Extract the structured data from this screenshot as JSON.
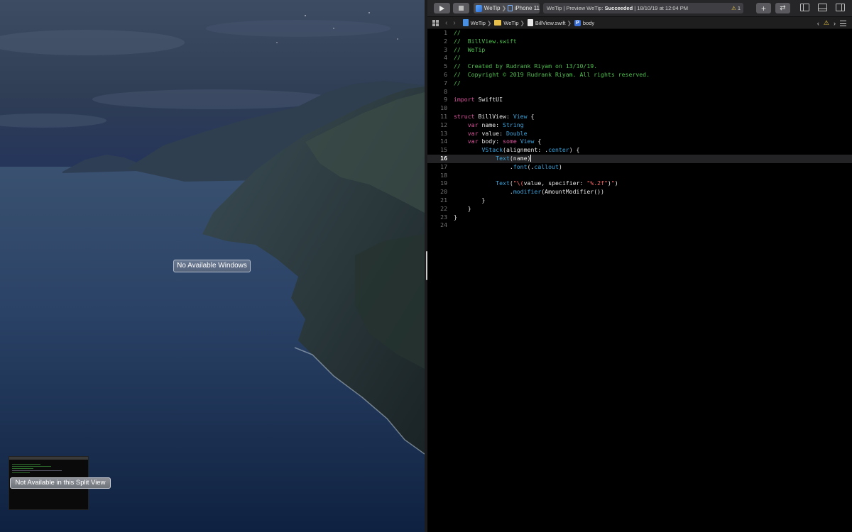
{
  "left_pane": {
    "no_windows_label": "No Available Windows",
    "split_view_label": "Not Available in this Split View"
  },
  "toolbar": {
    "run_icon": "play-icon",
    "stop_icon": "stop-icon",
    "scheme_app": "WeTip",
    "scheme_device": "iPhone 11",
    "status_prefix": "WeTip | Preview WeTip: ",
    "status_result": "Succeeded",
    "status_suffix": " | 18/10/19 at 12:04 PM",
    "warning_count": "1",
    "add_label": "+",
    "swap_label": "⇄"
  },
  "jumpbar": {
    "project": "WeTip",
    "group": "WeTip",
    "file": "BillView.swift",
    "symbol_badge": "P",
    "symbol": "body",
    "prev": "‹",
    "warn": "⚠",
    "next": "›"
  },
  "editor": {
    "current_line": 16,
    "lines": [
      [
        [
          "c",
          "//"
        ]
      ],
      [
        [
          "c",
          "//  BillView.swift"
        ]
      ],
      [
        [
          "c",
          "//  WeTip"
        ]
      ],
      [
        [
          "c",
          "//"
        ]
      ],
      [
        [
          "c",
          "//  Created by Rudrank Riyam on 13/10/19."
        ]
      ],
      [
        [
          "c",
          "//  Copyright © 2019 Rudrank Riyam. All rights reserved."
        ]
      ],
      [
        [
          "c",
          "//"
        ]
      ],
      [],
      [
        [
          "k",
          "import"
        ],
        [
          "p",
          " SwiftUI"
        ]
      ],
      [],
      [
        [
          "k",
          "struct"
        ],
        [
          "p",
          " BillView: "
        ],
        [
          "t",
          "View"
        ],
        [
          "p",
          " {"
        ]
      ],
      [
        [
          "p",
          "    "
        ],
        [
          "k",
          "var"
        ],
        [
          "p",
          " name: "
        ],
        [
          "t",
          "String"
        ]
      ],
      [
        [
          "p",
          "    "
        ],
        [
          "k",
          "var"
        ],
        [
          "p",
          " value: "
        ],
        [
          "t",
          "Double"
        ]
      ],
      [
        [
          "p",
          "    "
        ],
        [
          "k",
          "var"
        ],
        [
          "p",
          " body: "
        ],
        [
          "k",
          "some"
        ],
        [
          "p",
          " "
        ],
        [
          "t",
          "View"
        ],
        [
          "p",
          " {"
        ]
      ],
      [
        [
          "p",
          "        "
        ],
        [
          "f",
          "VStack"
        ],
        [
          "p",
          "(alignment: ."
        ],
        [
          "f",
          "center"
        ],
        [
          "p",
          ") {"
        ]
      ],
      [
        [
          "p",
          "            "
        ],
        [
          "f",
          "Text"
        ],
        [
          "p",
          "(name)"
        ]
      ],
      [
        [
          "p",
          "                ."
        ],
        [
          "f",
          "font"
        ],
        [
          "p",
          "(."
        ],
        [
          "f",
          "callout"
        ],
        [
          "p",
          ")"
        ]
      ],
      [],
      [
        [
          "p",
          "            "
        ],
        [
          "f",
          "Text"
        ],
        [
          "p",
          "("
        ],
        [
          "s",
          "\"\\("
        ],
        [
          "p",
          "value, specifier: "
        ],
        [
          "s",
          "\"%.2f\""
        ],
        [
          "p",
          ")"
        ],
        [
          "s",
          "\""
        ],
        [
          "p",
          ")"
        ]
      ],
      [
        [
          "p",
          "                ."
        ],
        [
          "f",
          "modifier"
        ],
        [
          "p",
          "(AmountModifier())"
        ]
      ],
      [
        [
          "p",
          "        }"
        ]
      ],
      [
        [
          "p",
          "    }"
        ]
      ],
      [
        [
          "p",
          "}"
        ]
      ],
      []
    ]
  }
}
